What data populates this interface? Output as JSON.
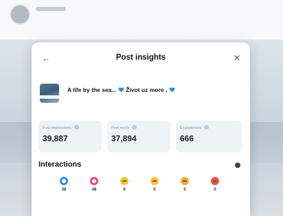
{
  "background": {
    "author": "",
    "meta": "",
    "bg_color": "#e9ecf1"
  },
  "modal": {
    "title": "Post insights",
    "back_icon": "arrow-left-icon",
    "close_icon": "close-icon",
    "post": {
      "title_part1": "A life by the sea...",
      "title_part2": "Život uz more ,",
      "subtitle": ""
    },
    "stats": [
      {
        "label": "Post impressions",
        "value": "39,887"
      },
      {
        "label": "Post reach",
        "value": "37,894"
      },
      {
        "label": "Engagement",
        "value": "666"
      }
    ],
    "interactions": {
      "title": "Interactions",
      "reactions": [
        {
          "type": "like",
          "count": "38",
          "color": "#2a8ce8"
        },
        {
          "type": "love",
          "count": "48",
          "color": "#f0447a"
        },
        {
          "type": "haha",
          "count": "6",
          "color": "#f6c33b"
        },
        {
          "type": "wow",
          "count": "0",
          "color": "#f6c33b"
        },
        {
          "type": "sad",
          "count": "0",
          "color": "#f2a93b"
        },
        {
          "type": "angry",
          "count": "0",
          "color": "#e8564a"
        }
      ]
    }
  }
}
